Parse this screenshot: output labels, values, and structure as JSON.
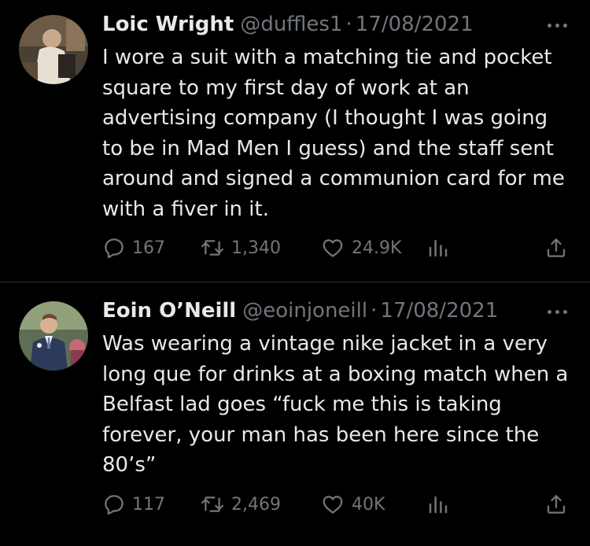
{
  "tweets": [
    {
      "name": "Loic Wright",
      "handle": "@duffles1",
      "separator": "·",
      "date": "17/08/2021",
      "text": "I wore a suit with a matching tie and pocket square to my first day of work at an advertising company (I thought I was going to be in Mad Men I guess) and the staff sent around and signed a communion card for me with a fiver in it.",
      "replies": "167",
      "retweets": "1,340",
      "likes": "24.9K"
    },
    {
      "name": "Eoin O’Neill",
      "handle": "@eoinjoneill",
      "separator": "·",
      "date": "17/08/2021",
      "text": "Was wearing a vintage nike jacket in a very long que for drinks at a boxing match when a Belfast lad goes “fuck me this is taking forever, your man has been here since the 80’s”",
      "replies": "117",
      "retweets": "2,469",
      "likes": "40K"
    }
  ],
  "icons": {
    "reply": "reply-icon",
    "retweet": "retweet-icon",
    "like": "heart-icon",
    "views": "analytics-icon",
    "share": "share-icon",
    "more": "more-icon"
  },
  "colors": {
    "background": "#000000",
    "text": "#e7e9ea",
    "muted": "#71767b",
    "divider": "#2f3336"
  }
}
